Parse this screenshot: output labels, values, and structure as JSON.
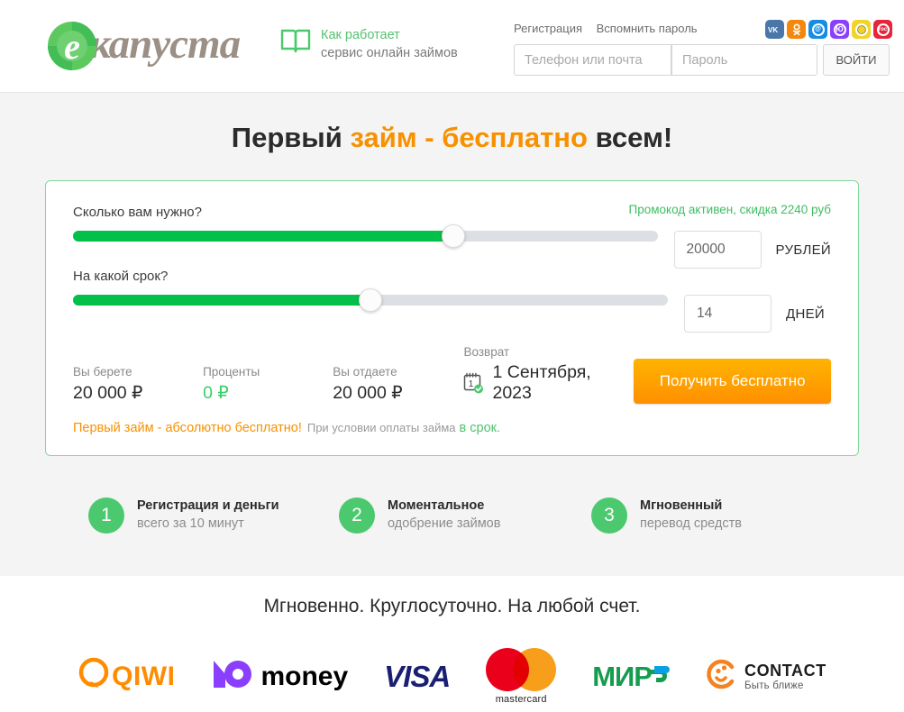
{
  "header": {
    "logo_word": "капуста",
    "logo_icon": "cabbage-e-logo",
    "howto_line1": "Как работает",
    "howto_line2": "сервис онлайн займов",
    "howto_icon": "open-book-icon",
    "register_link": "Регистрация",
    "forgot_link": "Вспомнить пароль",
    "phone_placeholder": "Телефон или почта",
    "password_placeholder": "Пароль",
    "login_button": "ВОЙТИ",
    "socials": [
      {
        "name": "vk",
        "glyph": "VK",
        "color": "#4a76a8"
      },
      {
        "name": "odnoklassniki",
        "glyph": "OK",
        "color": "#f3880d"
      },
      {
        "name": "mailru",
        "glyph": "@",
        "color": "#168de2"
      },
      {
        "name": "yandex",
        "glyph": "Ю",
        "color": "#8b3ffd"
      },
      {
        "name": "sberbank",
        "glyph": "",
        "color": "#f2d32b"
      },
      {
        "name": "gosuslugi",
        "glyph": "гос",
        "color": "#e5253b"
      }
    ]
  },
  "hero": {
    "title_part1": "Первый ",
    "title_highlight": "займ - бесплатно",
    "title_part2": " всем!"
  },
  "calculator": {
    "promo_text": "Промокод активен, скидка 2240 руб",
    "amount_label": "Сколько вам нужно?",
    "amount_value": "20000",
    "amount_unit": "РУБЛЕЙ",
    "amount_slider_percent": 65,
    "term_label": "На какой срок?",
    "term_value": "14",
    "term_unit": "ДНЕЙ",
    "term_slider_percent": 50,
    "stepper_up": "+",
    "stepper_down": "-",
    "summary": [
      {
        "caption": "Вы берете",
        "value": "20 000 ₽",
        "green": false
      },
      {
        "caption": "Проценты",
        "value": "0 ₽",
        "green": true
      },
      {
        "caption": "Вы отдаете",
        "value": "20 000 ₽",
        "green": false
      }
    ],
    "return_caption": "Возврат",
    "return_date": "1 Сентября, 2023",
    "return_day_number": "1",
    "submit_button": "Получить бесплатно",
    "footnote_orange": "Первый займ - абсолютно бесплатно!",
    "footnote_gray": "При условии оплаты займа",
    "footnote_green": "в срок."
  },
  "steps": [
    {
      "number": "1",
      "title": "Регистрация и деньги",
      "subtitle": "всего за 10 минут"
    },
    {
      "number": "2",
      "title": "Моментальное",
      "subtitle": "одобрение займов"
    },
    {
      "number": "3",
      "title": "Мгновенный",
      "subtitle": "перевод средств"
    }
  ],
  "payments": {
    "title": "Мгновенно. Круглосуточно. На любой счет.",
    "logos": [
      {
        "name": "qiwi",
        "text": "QIWI"
      },
      {
        "name": "yoomoney",
        "text": "money"
      },
      {
        "name": "visa",
        "text": "VISA"
      },
      {
        "name": "mastercard",
        "text": "mastercard"
      },
      {
        "name": "mir",
        "text": "МИР"
      },
      {
        "name": "contact",
        "text": "CONTACT",
        "subtext": "Быть ближе"
      }
    ]
  },
  "colors": {
    "brand_green": "#03c04a",
    "accent_orange": "#f79100",
    "page_bg": "#f4f4f4"
  }
}
